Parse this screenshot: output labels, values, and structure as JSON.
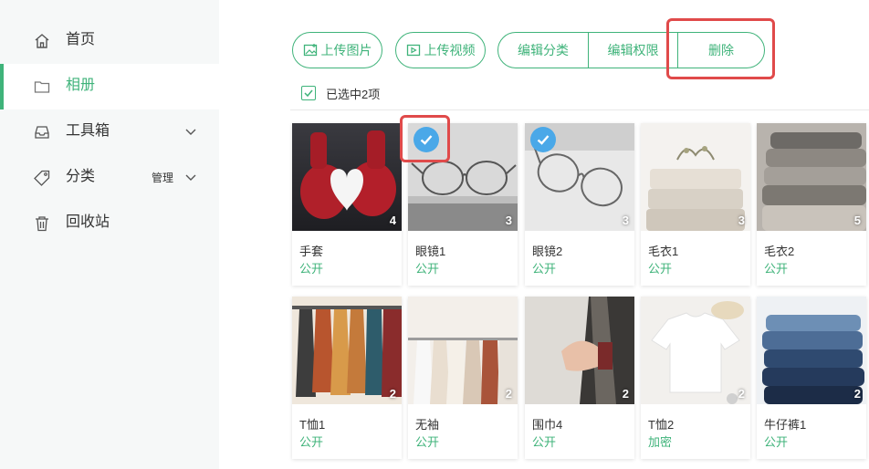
{
  "sidebar": {
    "items": [
      {
        "label": "首页",
        "icon": "home-icon"
      },
      {
        "label": "相册",
        "icon": "folder-icon",
        "active": true
      },
      {
        "label": "工具箱",
        "icon": "inbox-icon"
      },
      {
        "label": "分类",
        "icon": "tag-icon",
        "extra": "管理"
      },
      {
        "label": "回收站",
        "icon": "trash-icon"
      }
    ]
  },
  "toolbar": {
    "upload_image": "上传图片",
    "upload_video": "上传视频",
    "edit_category": "编辑分类",
    "edit_permission": "编辑权限",
    "delete": "删除"
  },
  "selection": {
    "text": "已选中2项"
  },
  "colors": {
    "accent": "#3fb37a",
    "highlight": "#e04a4a",
    "check": "#4aa8e8"
  },
  "photos": [
    {
      "name": "手套",
      "status": "公开",
      "count": "4",
      "selected": false,
      "art": "gloves"
    },
    {
      "name": "眼镜1",
      "status": "公开",
      "count": "3",
      "selected": true,
      "art": "glasses1"
    },
    {
      "name": "眼镜2",
      "status": "公开",
      "count": "3",
      "selected": true,
      "art": "glasses2"
    },
    {
      "name": "毛衣1",
      "status": "公开",
      "count": "3",
      "selected": false,
      "art": "sweater1"
    },
    {
      "name": "毛衣2",
      "status": "公开",
      "count": "5",
      "selected": false,
      "art": "sweater2"
    },
    {
      "name": "T恤1",
      "status": "公开",
      "count": "2",
      "selected": false,
      "art": "rack1"
    },
    {
      "name": "无袖",
      "status": "公开",
      "count": "2",
      "selected": false,
      "art": "rack2"
    },
    {
      "name": "围巾4",
      "status": "公开",
      "count": "2",
      "selected": false,
      "art": "scarf"
    },
    {
      "name": "T恤2",
      "status": "加密",
      "count": "2",
      "selected": false,
      "art": "tshirt"
    },
    {
      "name": "牛仔裤1",
      "status": "公开",
      "count": "2",
      "selected": false,
      "art": "jeans"
    }
  ]
}
